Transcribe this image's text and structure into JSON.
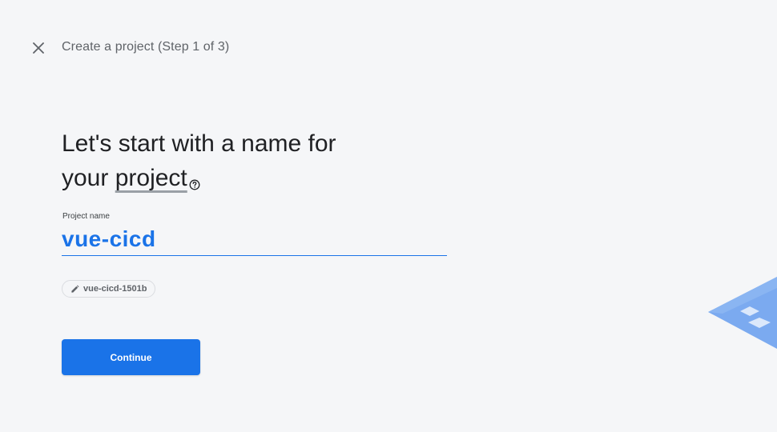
{
  "header": {
    "close_icon": "close-icon",
    "title": "Create a project (Step 1 of 3)"
  },
  "main": {
    "headline_line1": "Let's start with a name for",
    "headline_line2_prefix": "your ",
    "headline_term": "project",
    "help_icon": "help-circle-icon"
  },
  "form": {
    "project_name_label": "Project name",
    "project_name_value": "vue-cicd",
    "project_id_chip": "vue-cicd-1501b",
    "chip_icon": "pencil-icon",
    "continue_label": "Continue"
  },
  "colors": {
    "accent": "#1a73e8",
    "background": "#f5f6f8",
    "text_primary": "#202124",
    "text_secondary": "#5f6368"
  }
}
